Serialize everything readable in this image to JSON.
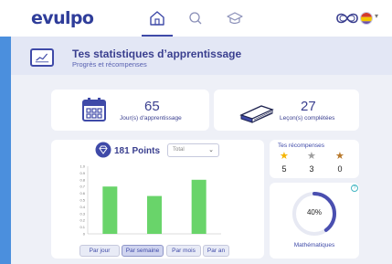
{
  "app": {
    "logo_text": "evulpo"
  },
  "nav": {
    "icons": [
      "home-icon",
      "search-icon",
      "graduation-cap-icon"
    ],
    "active": "home",
    "accent": "#3f4aa8"
  },
  "header": {
    "title": "Tes statistiques d’apprentissage",
    "subtitle": "Progrès et récompenses"
  },
  "stats": {
    "days": {
      "value": "65",
      "label": "Jour(s) d'apprentissage"
    },
    "lessons": {
      "value": "27",
      "label": "Leçon(s) complétées"
    }
  },
  "points": {
    "value_label": "181 Points",
    "filter_selected": "Total"
  },
  "chart_data": {
    "type": "bar",
    "categories": [
      "",
      "",
      ""
    ],
    "values": [
      0.7,
      0.56,
      0.8
    ],
    "ylim": [
      0,
      1.0
    ],
    "yticks": [
      "0",
      "0.1",
      "0.2",
      "0.3",
      "0.4",
      "0.5",
      "0.6",
      "0.7",
      "0.8",
      "0.9",
      "1.0"
    ],
    "grid": false,
    "bar_color": "#69d46a"
  },
  "periods": {
    "day": "Par jour",
    "week": "Par semaine",
    "month": "Par mois",
    "year": "Par an",
    "active": "week"
  },
  "rewards": {
    "title": "Tes récompenses",
    "gold": "5",
    "silver": "3",
    "bronze": "0",
    "colors": {
      "gold": "#f5b400",
      "silver": "#9e9e9e",
      "bronze": "#b7772a"
    }
  },
  "progress": {
    "percent_label": "40%",
    "percent": 40,
    "subject": "Mathématiques",
    "color": "#4a4fb0"
  }
}
